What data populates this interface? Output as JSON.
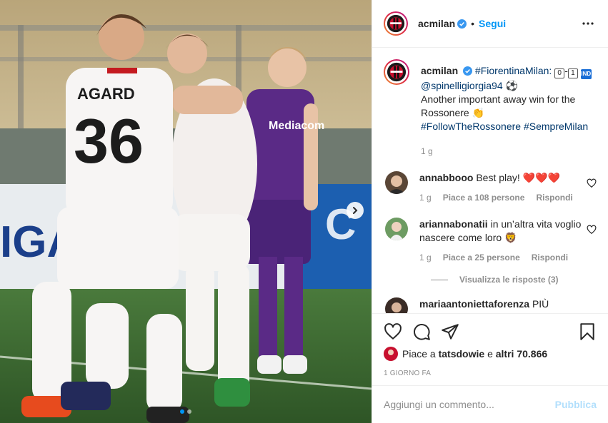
{
  "photo": {
    "jersey_name": "AGARD",
    "jersey_number": "36",
    "sponsor_text": "Mediacom",
    "carousel_dots": 2,
    "active_dot": 0
  },
  "post": {
    "username": "acmilan",
    "follow_label": "Segui",
    "caption_tags_1": "#FiorentinaMilan:",
    "score_left": "0",
    "score_sep": "-",
    "score_right": "1",
    "badge_text": "IND",
    "mention": "@spinelligiorgia94",
    "caption_text": "Another important away win for the Rossonere",
    "caption_tags_2": "#FollowTheRossonere #SempreMilan",
    "caption_time": "1 g"
  },
  "comments": [
    {
      "username": "annabbooo",
      "text": "Best play! ❤️❤️❤️",
      "time": "1 g",
      "likes": "Piace a 108 persone",
      "reply": "Rispondi"
    },
    {
      "username": "ariannabonatii",
      "text": "in un’altra vita voglio nascere come loro 🦁",
      "time": "1 g",
      "likes": "Piace a 25 persone",
      "reply": "Rispondi",
      "view_replies": "Visualizza le risposte (3)"
    },
    {
      "username": "mariaantoniettaforenza",
      "text": "PIÙ"
    }
  ],
  "likes": {
    "prefix": "Piace a",
    "user": "tatsdowie",
    "joiner": "e",
    "others": "altri 70.866"
  },
  "date": "1 GIORNO FA",
  "add_comment": {
    "placeholder": "Aggiungi un commento...",
    "publish_label": "Pubblica"
  },
  "colors": {
    "link_blue": "#0095f6",
    "tag_blue": "#00376b",
    "muted": "#8e8e8e",
    "heart_red": "#ed1c24",
    "publish_disabled": "#b2dffc"
  }
}
